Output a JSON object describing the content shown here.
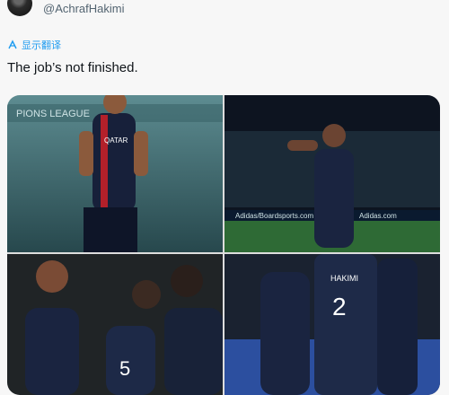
{
  "author": {
    "handle": "@AchrafHakimi"
  },
  "translate": {
    "icon": "translate-icon",
    "label": "显示翻译"
  },
  "tweet": {
    "text": "The job’s not finished."
  },
  "media": {
    "photo1": {
      "sign_text": "PIONS LEAGUE",
      "sponsor": "QATAR"
    },
    "photo2": {
      "board1": "Adidas/Boardsports.com",
      "board2": "Adidas.com"
    },
    "photo3": {
      "jersey_number": "5"
    },
    "photo4": {
      "jersey_name": "HAKIMI",
      "jersey_number": "2"
    }
  }
}
